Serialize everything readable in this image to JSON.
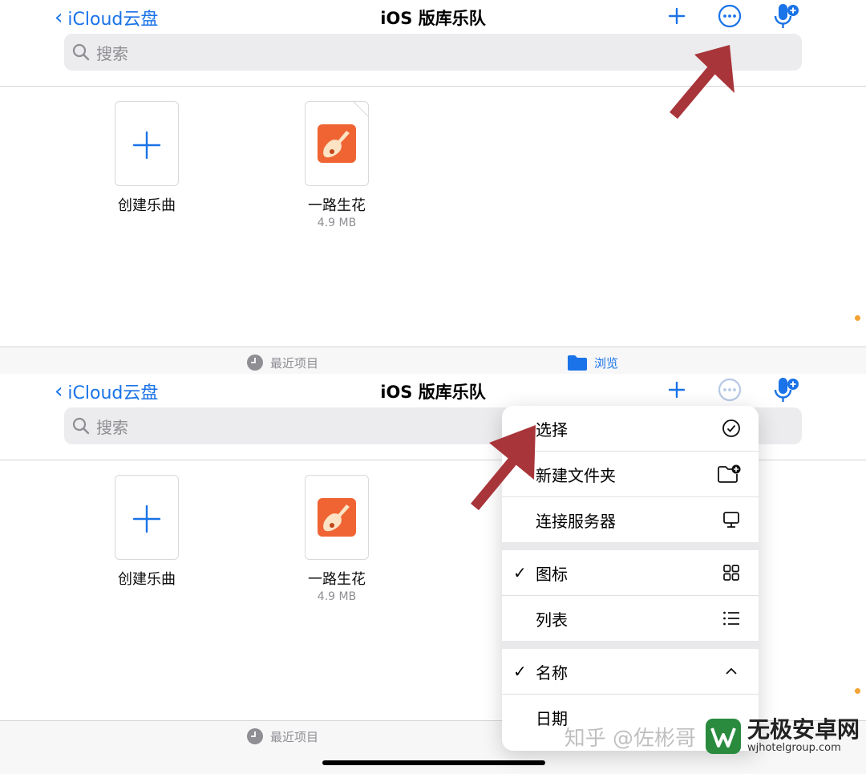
{
  "nav": {
    "back_label": "iCloud云盘",
    "title": "iOS 版库乐队"
  },
  "search": {
    "placeholder": "搜索"
  },
  "files": [
    {
      "label": "创建乐曲"
    },
    {
      "label": "一路生花",
      "size": "4.9 MB"
    }
  ],
  "tabbar": {
    "recent_label": "最近项目",
    "browse_label": "浏览"
  },
  "menu": {
    "select": "选择",
    "new_folder": "新建文件夹",
    "connect_server": "连接服务器",
    "icons": "图标",
    "list": "列表",
    "name": "名称",
    "date": "日期"
  },
  "watermark": {
    "overlay_text": "知乎 @佐彬哥",
    "brand": "无极安卓网",
    "url": "wjhotelgroup.com"
  },
  "colors": {
    "accent": "#1a73e8",
    "arrow": "#a8353a",
    "tab_inactive": "#8e8e93"
  }
}
